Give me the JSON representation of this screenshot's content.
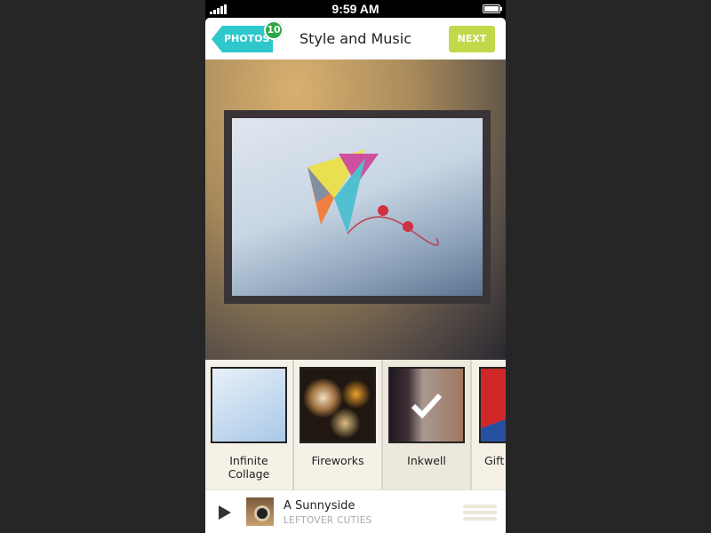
{
  "status_bar": {
    "time": "9:59 AM",
    "signal_icon": "signal-bars-icon",
    "battery_icon": "battery-icon"
  },
  "header": {
    "back_label": "PHOTOS",
    "photo_count": "10",
    "title": "Style and Music",
    "next_label": "NEXT",
    "colors": {
      "back": "#2ec8cc",
      "badge": "#2aa845",
      "next": "#bfd94a"
    }
  },
  "styles": [
    {
      "label": "Infinite Collage",
      "selected": false
    },
    {
      "label": "Fireworks",
      "selected": false
    },
    {
      "label": "Inkwell",
      "selected": true
    },
    {
      "label": "Gift",
      "selected": false
    }
  ],
  "player": {
    "song": "A Sunnyside",
    "artist": "LEFTOVER CUTIES",
    "play_icon": "play-icon",
    "menu_icon": "hamburger-icon"
  }
}
